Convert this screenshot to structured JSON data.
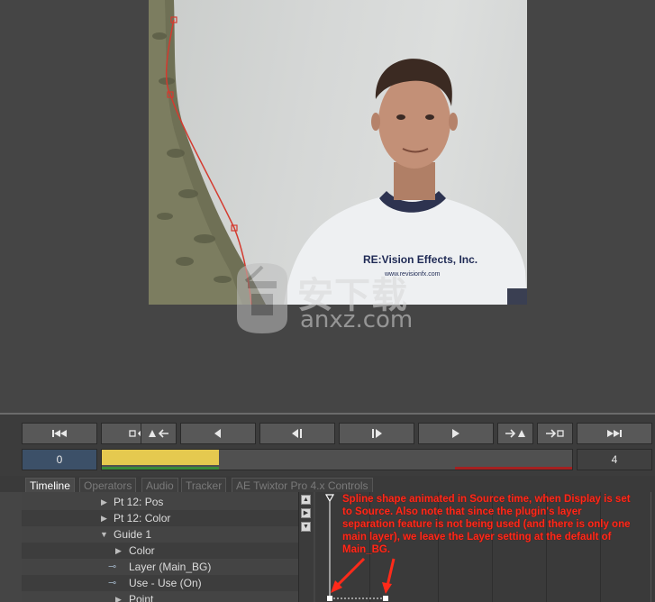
{
  "watermark": {
    "text": "安下载",
    "sub": "anxz.com"
  },
  "transport": {
    "buttons": [
      {
        "name": "goto-start-button",
        "glyph": "⏮"
      },
      {
        "name": "mark-in-button",
        "glyph": "□🡐"
      },
      {
        "name": "prev-key-button",
        "glyph": "⯊🡐"
      },
      {
        "name": "play-reverse-button",
        "glyph": "◀"
      },
      {
        "name": "step-back-button",
        "glyph": "◀‖"
      },
      {
        "name": "step-forward-button",
        "glyph": "‖▶"
      },
      {
        "name": "play-button",
        "glyph": "▶"
      },
      {
        "name": "next-key-button",
        "glyph": "🡒⯊"
      },
      {
        "name": "mark-out-button",
        "glyph": "🡒□"
      },
      {
        "name": "goto-end-button",
        "glyph": "⏭"
      }
    ],
    "frame_start": "0",
    "frame_end": "4"
  },
  "tabs": [
    "Timeline",
    "Operators",
    "Audio",
    "Tracker",
    "AE Twixtor Pro 4.x Controls"
  ],
  "tree": [
    {
      "label": "Pt 12: Pos"
    },
    {
      "label": "Pt 12: Color"
    },
    {
      "label": "Guide 1"
    },
    {
      "label": "Color"
    },
    {
      "label": "Layer  (Main_BG)"
    },
    {
      "label": "Use - Use  (On)"
    },
    {
      "label": "Point"
    }
  ],
  "annotation": "Spline shape animated in Source time, when Display is set to Source.  Also note that since the plugin's layer separation feature is not being used (and there is only one main layer), we leave the Layer setting at the default of Main_BG.",
  "shirt_text": "RE:Vision Effects, Inc.",
  "colors": {
    "accent": "#e5c94f",
    "annotation": "#ff2a1a",
    "frame_field": "#3c5068"
  }
}
